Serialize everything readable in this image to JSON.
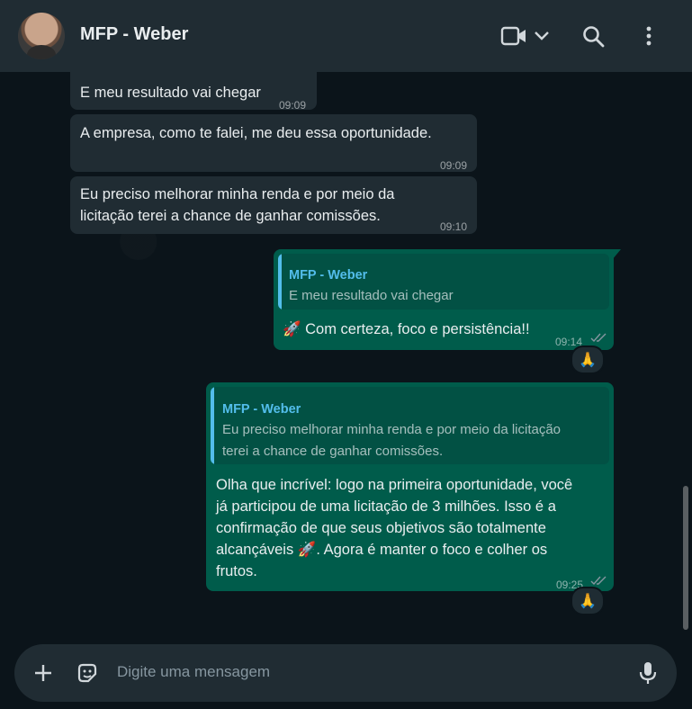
{
  "header": {
    "contact_name": "MFP - Weber",
    "icons": [
      "avatar",
      "video-call-icon",
      "chevron-down-icon",
      "search-icon",
      "menu-icon"
    ]
  },
  "messages": [
    {
      "direction": "in",
      "text": "E meu resultado vai chegar",
      "time": "09:09"
    },
    {
      "direction": "in",
      "text": "A empresa, como te falei, me deu essa oportunidade.",
      "time": "09:09"
    },
    {
      "direction": "in",
      "text_lines": [
        "Eu preciso melhorar minha renda e por meio da",
        "licitação terei a chance de ganhar comissões."
      ],
      "time": "09:10"
    },
    {
      "direction": "out",
      "quote_name": "MFP - Weber",
      "quote_text": "E meu resultado vai chegar",
      "text": "🚀 Com certeza, foco e persistência!!",
      "time": "09:14",
      "reaction": "🙏"
    },
    {
      "direction": "out",
      "quote_name": "MFP - Weber",
      "quote_lines": [
        "Eu preciso melhorar minha renda e por meio da licitação",
        "terei a chance de ganhar comissões."
      ],
      "text_lines": [
        "Olha que incrível: logo na primeira oportunidade, você",
        "já participou de uma licitação de 3 milhões. Isso é a",
        "confirmação de que seus objetivos são totalmente",
        "alcançáveis 🚀. Agora é manter o foco e colher os",
        "frutos."
      ],
      "time": "09:25",
      "reaction": "🙏"
    }
  ],
  "composer": {
    "placeholder": "Digite uma mensagem",
    "icons": [
      "plus-icon",
      "sticker-icon",
      "microphone-icon"
    ]
  },
  "colors": {
    "header": "#202c33",
    "incoming": "#202c33",
    "outgoing": "#005c4b",
    "quote_accent": "#53bdeb",
    "background": "#0b141a"
  }
}
